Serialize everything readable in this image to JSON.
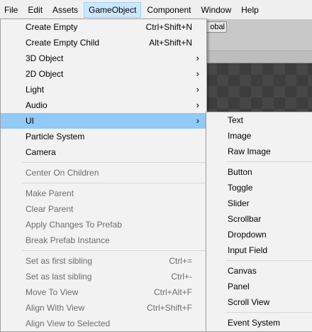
{
  "menubar": {
    "items": [
      "File",
      "Edit",
      "Assets",
      "GameObject",
      "Component",
      "Window",
      "Help"
    ],
    "active": "GameObject"
  },
  "toolbar": {
    "global_label": "obal"
  },
  "gameobject_menu": {
    "groups": [
      [
        {
          "label": "Create Empty",
          "shortcut": "Ctrl+Shift+N",
          "enabled": true
        },
        {
          "label": "Create Empty Child",
          "shortcut": "Alt+Shift+N",
          "enabled": true
        },
        {
          "label": "3D Object",
          "submenu": true,
          "enabled": true
        },
        {
          "label": "2D Object",
          "submenu": true,
          "enabled": true
        },
        {
          "label": "Light",
          "submenu": true,
          "enabled": true
        },
        {
          "label": "Audio",
          "submenu": true,
          "enabled": true
        },
        {
          "label": "UI",
          "submenu": true,
          "enabled": true,
          "highlighted": true
        },
        {
          "label": "Particle System",
          "enabled": true
        },
        {
          "label": "Camera",
          "enabled": true
        }
      ],
      [
        {
          "label": "Center On Children",
          "enabled": false
        }
      ],
      [
        {
          "label": "Make Parent",
          "enabled": false
        },
        {
          "label": "Clear Parent",
          "enabled": false
        },
        {
          "label": "Apply Changes To Prefab",
          "enabled": false
        },
        {
          "label": "Break Prefab Instance",
          "enabled": false
        }
      ],
      [
        {
          "label": "Set as first sibling",
          "shortcut": "Ctrl+=",
          "enabled": false
        },
        {
          "label": "Set as last sibling",
          "shortcut": "Ctrl+-",
          "enabled": false
        },
        {
          "label": "Move To View",
          "shortcut": "Ctrl+Alt+F",
          "enabled": false
        },
        {
          "label": "Align With View",
          "shortcut": "Ctrl+Shift+F",
          "enabled": false
        },
        {
          "label": "Align View to Selected",
          "enabled": false
        }
      ]
    ]
  },
  "ui_submenu": {
    "groups": [
      [
        "Text",
        "Image",
        "Raw Image"
      ],
      [
        "Button",
        "Toggle",
        "Slider",
        "Scrollbar",
        "Dropdown",
        "Input Field"
      ],
      [
        "Canvas",
        "Panel",
        "Scroll View"
      ],
      [
        "Event System"
      ]
    ]
  },
  "colors": {
    "menu_bg": "#f2f2f2",
    "highlight": "#91c9f7",
    "menubar_active": "#cce8ff",
    "disabled_text": "#6d6d6d"
  },
  "icons": {
    "submenu_arrow": "chevron-right-icon"
  }
}
